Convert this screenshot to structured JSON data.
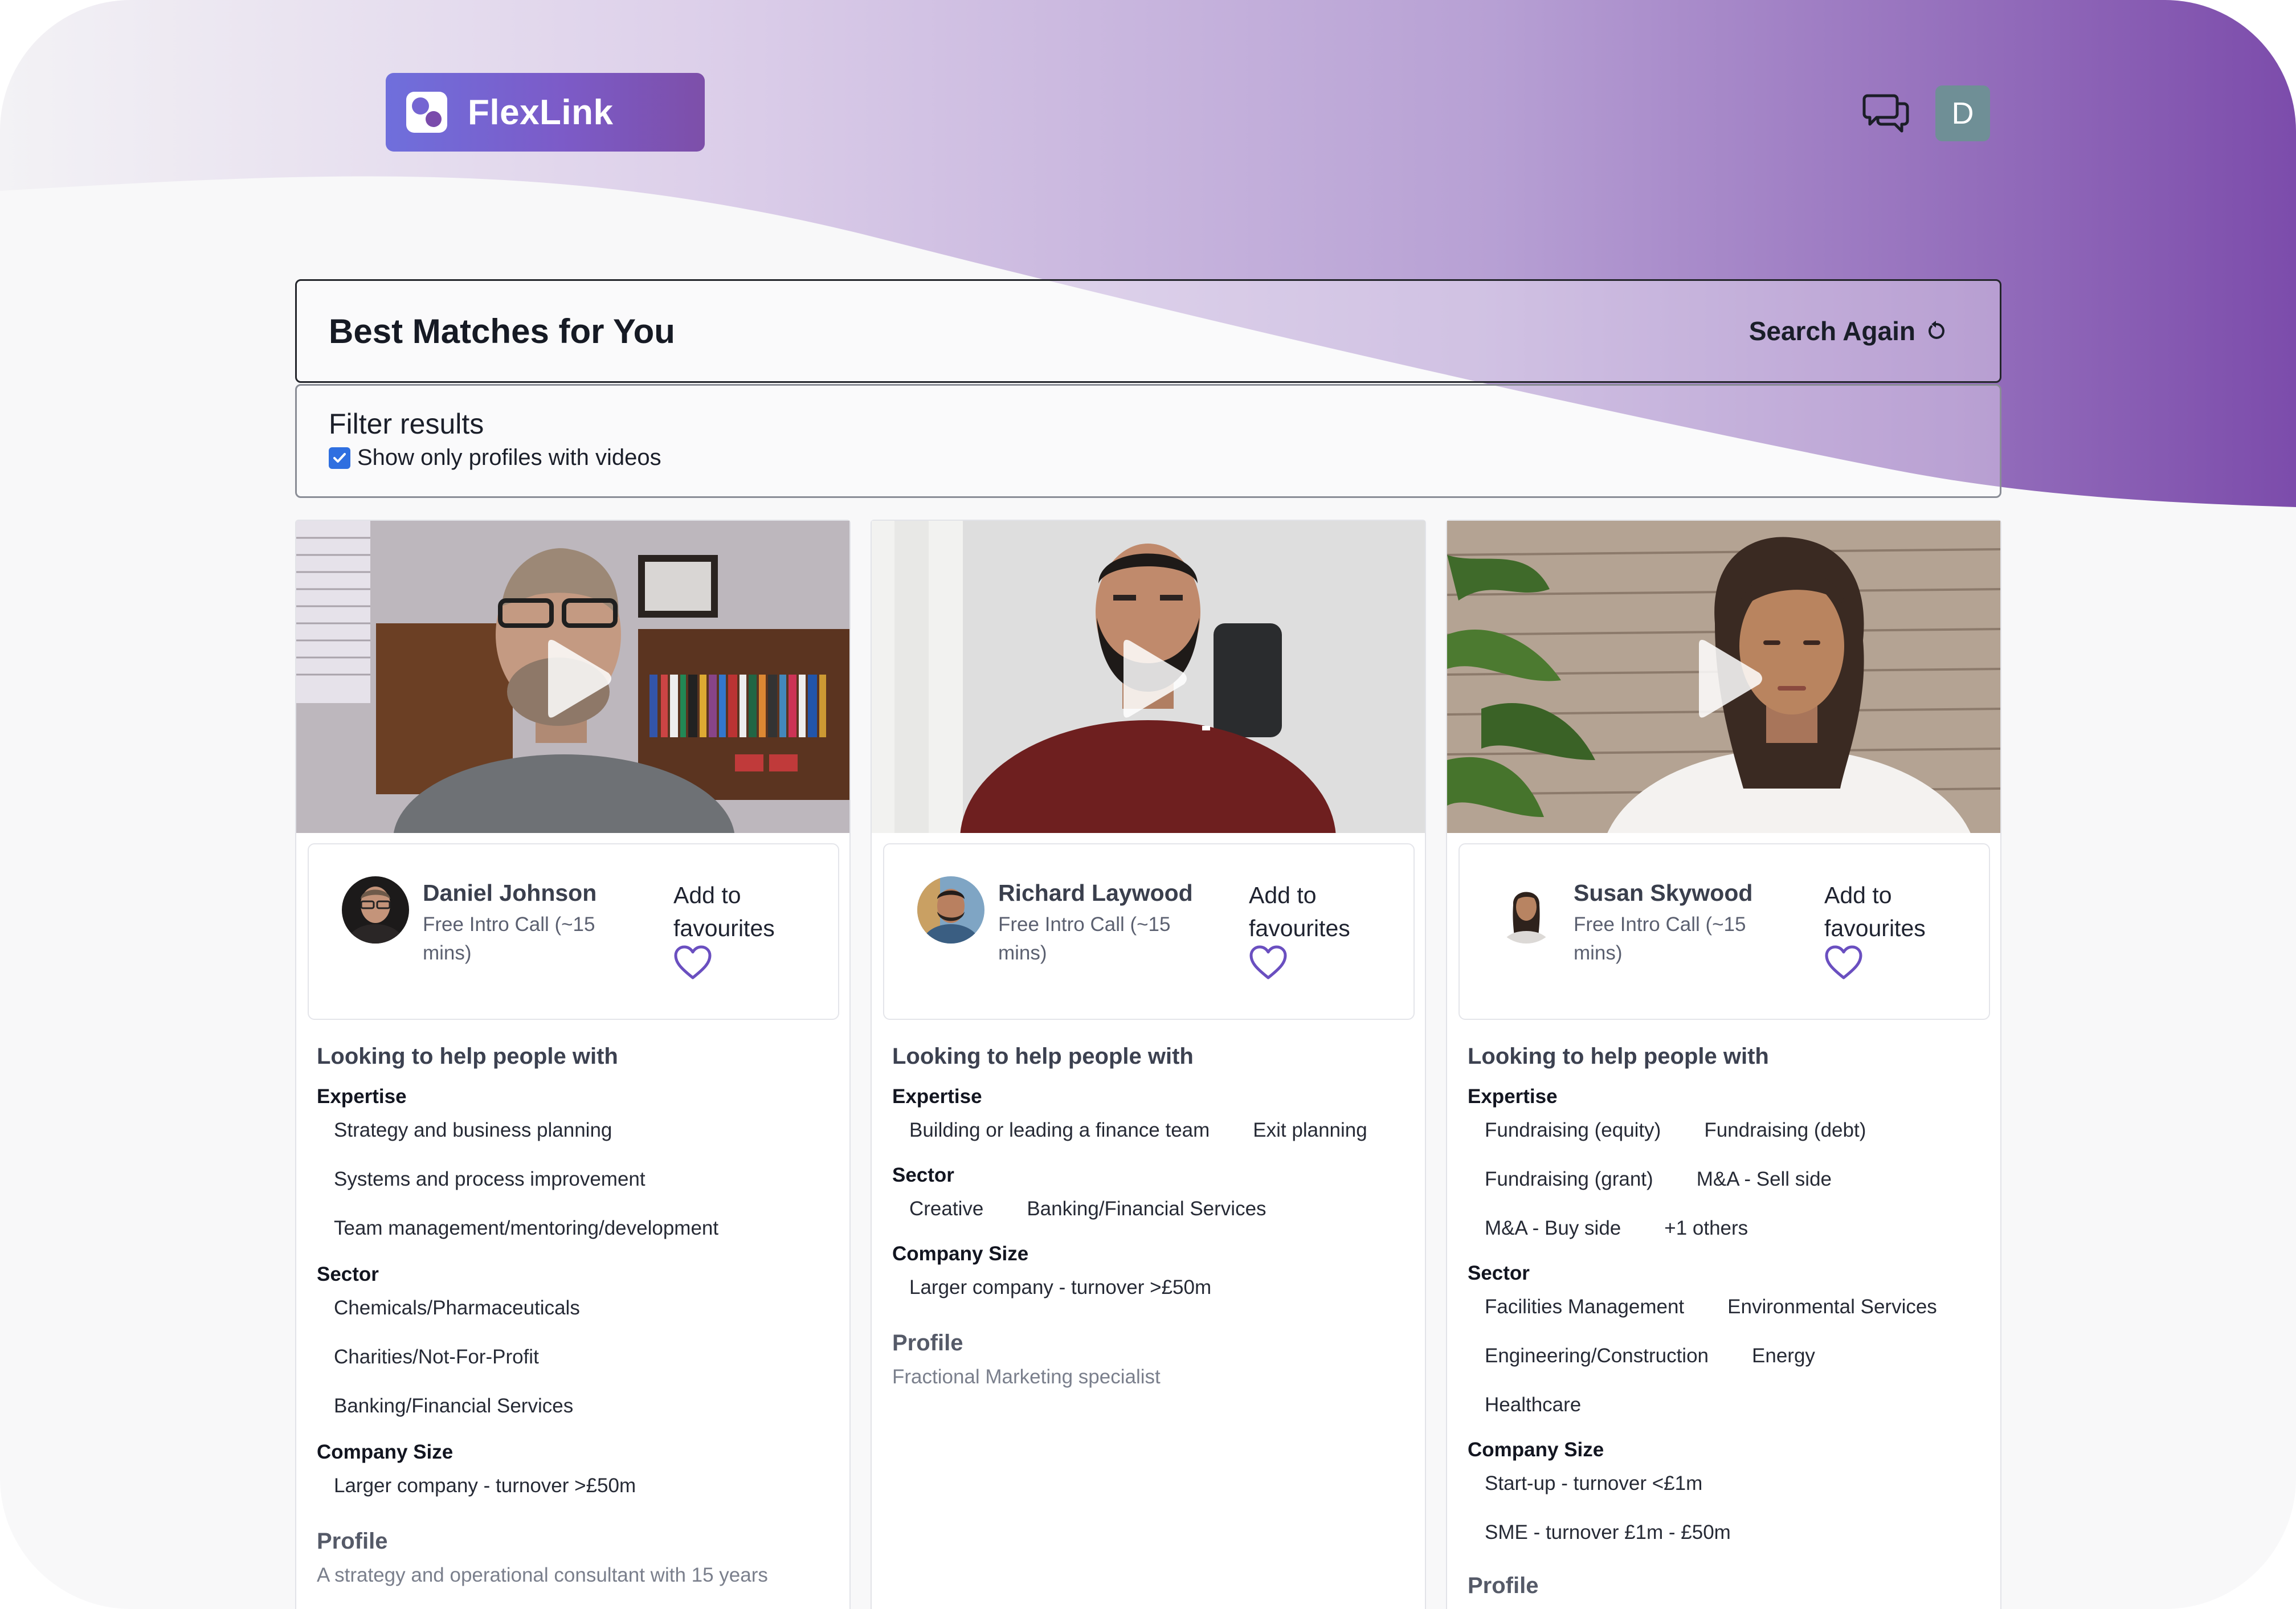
{
  "brand": {
    "name": "FlexLink"
  },
  "header": {
    "avatar_letter": "D"
  },
  "main": {
    "title": "Best Matches for You",
    "search_again": "Search Again",
    "filter": {
      "title": "Filter results",
      "video_only_label": "Show only profiles with videos",
      "video_only_checked": true
    }
  },
  "labels": {
    "fav": "Add to favourites",
    "looking": "Looking to help people with",
    "expertise": "Expertise",
    "sector": "Sector",
    "company_size": "Company Size",
    "profile": "Profile"
  },
  "cards": [
    {
      "name": "Daniel Johnson",
      "subtitle": "Free Intro Call (~15 mins)",
      "expertise": [
        "Strategy and business planning",
        "Systems and process improvement",
        "Team management/mentoring/development"
      ],
      "sector": [
        "Chemicals/Pharmaceuticals",
        "Charities/Not-For-Profit",
        "Banking/Financial Services"
      ],
      "company_size": [
        "Larger company - turnover >£50m"
      ],
      "profile": "A strategy and operational consultant with 15 years"
    },
    {
      "name": "Richard Laywood",
      "subtitle": "Free Intro Call (~15 mins)",
      "expertise": [
        "Building or leading a finance team",
        "Exit planning"
      ],
      "sector": [
        "Creative",
        "Banking/Financial Services"
      ],
      "company_size": [
        "Larger company - turnover >£50m"
      ],
      "profile": "Fractional Marketing specialist"
    },
    {
      "name": "Susan Skywood",
      "subtitle": "Free Intro Call (~15 mins)",
      "expertise": [
        "Fundraising (equity)",
        "Fundraising (debt)",
        "Fundraising (grant)",
        "M&A - Sell side",
        "M&A - Buy side",
        "+1 others"
      ],
      "sector": [
        "Facilities Management",
        "Environmental Services",
        "Engineering/Construction",
        "Energy",
        "Healthcare"
      ],
      "company_size": [
        "Start-up - turnover <£1m",
        "SME - turnover £1m - £50m"
      ],
      "profile": ""
    }
  ],
  "colors": {
    "accent": "#7b4fb0",
    "checkbox": "#2f6fe0",
    "heart": "#6a4fc0"
  }
}
